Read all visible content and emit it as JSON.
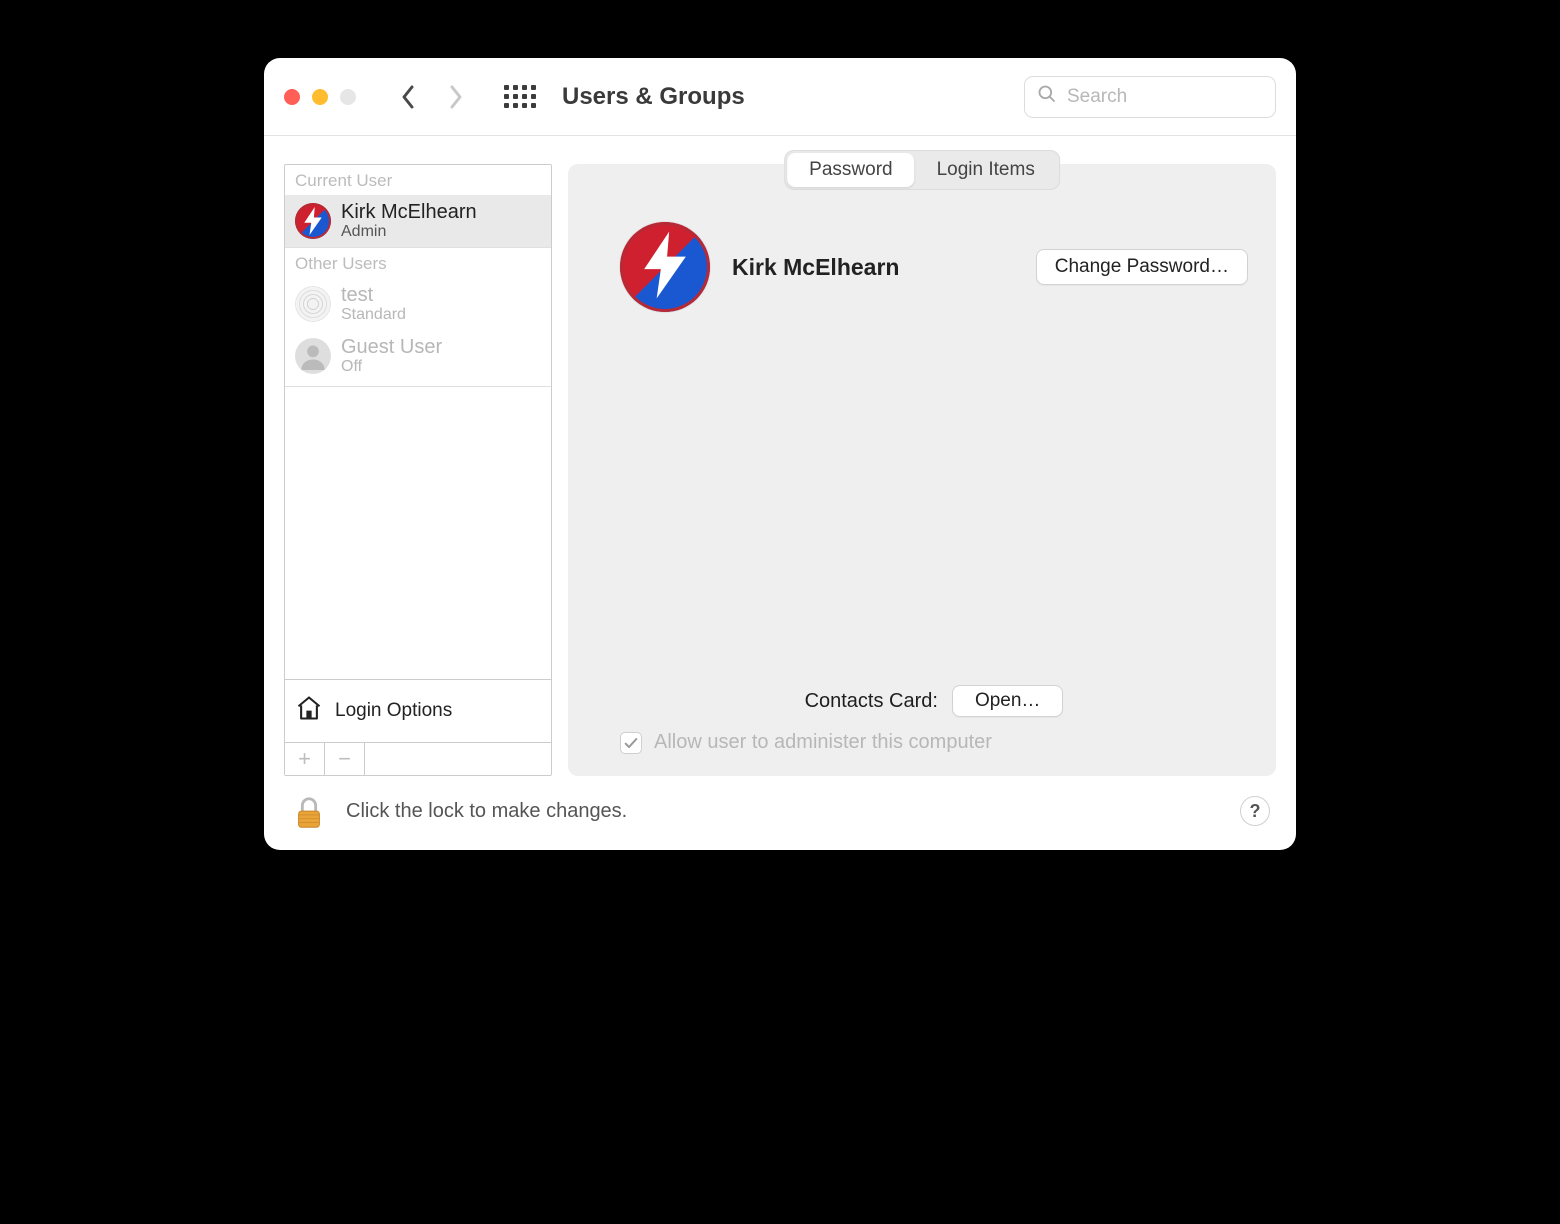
{
  "window": {
    "title": "Users & Groups",
    "search_placeholder": "Search"
  },
  "sidebar": {
    "current_label": "Current User",
    "other_label": "Other Users",
    "current_user": {
      "name": "Kirk McElhearn",
      "role": "Admin"
    },
    "other_users": [
      {
        "name": "test",
        "role": "Standard"
      },
      {
        "name": "Guest User",
        "role": "Off"
      }
    ],
    "login_options_label": "Login Options"
  },
  "tabs": {
    "password": "Password",
    "login_items": "Login Items"
  },
  "main": {
    "display_name": "Kirk McElhearn",
    "change_password_label": "Change Password…",
    "contacts_label": "Contacts Card:",
    "open_label": "Open…",
    "admin_checkbox_label": "Allow user to administer this computer"
  },
  "footer": {
    "lock_text": "Click the lock to make changes.",
    "help_label": "?"
  }
}
